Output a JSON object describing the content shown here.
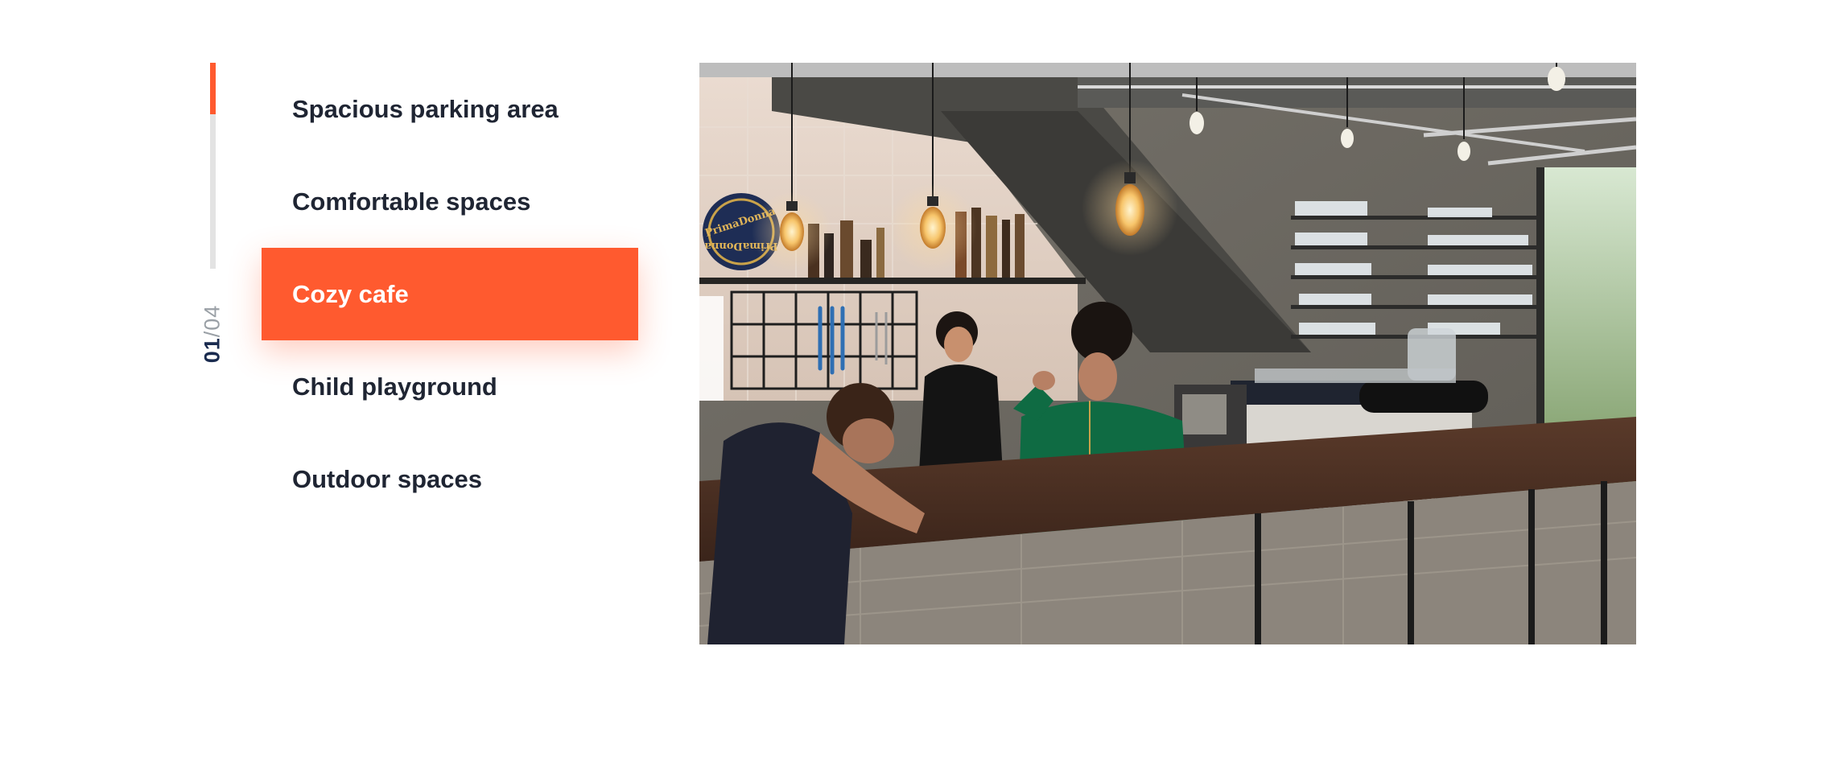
{
  "progress": {
    "current": "01",
    "separator": "/",
    "total": "04",
    "fraction": 0.25,
    "color": "#ff5a2f",
    "track_color": "#e3e3e3"
  },
  "menu": {
    "items": [
      {
        "label": "Spacious parking area",
        "active": false
      },
      {
        "label": "Comfortable spaces",
        "active": false
      },
      {
        "label": "Cozy cafe",
        "active": true
      },
      {
        "label": "Child playground",
        "active": false
      },
      {
        "label": "Outdoor spaces",
        "active": false
      }
    ],
    "accent": "#ff5a2f"
  },
  "photo": {
    "sign_text_top": "PrimaDonna",
    "sign_text_bottom": "PrimaDonna"
  }
}
